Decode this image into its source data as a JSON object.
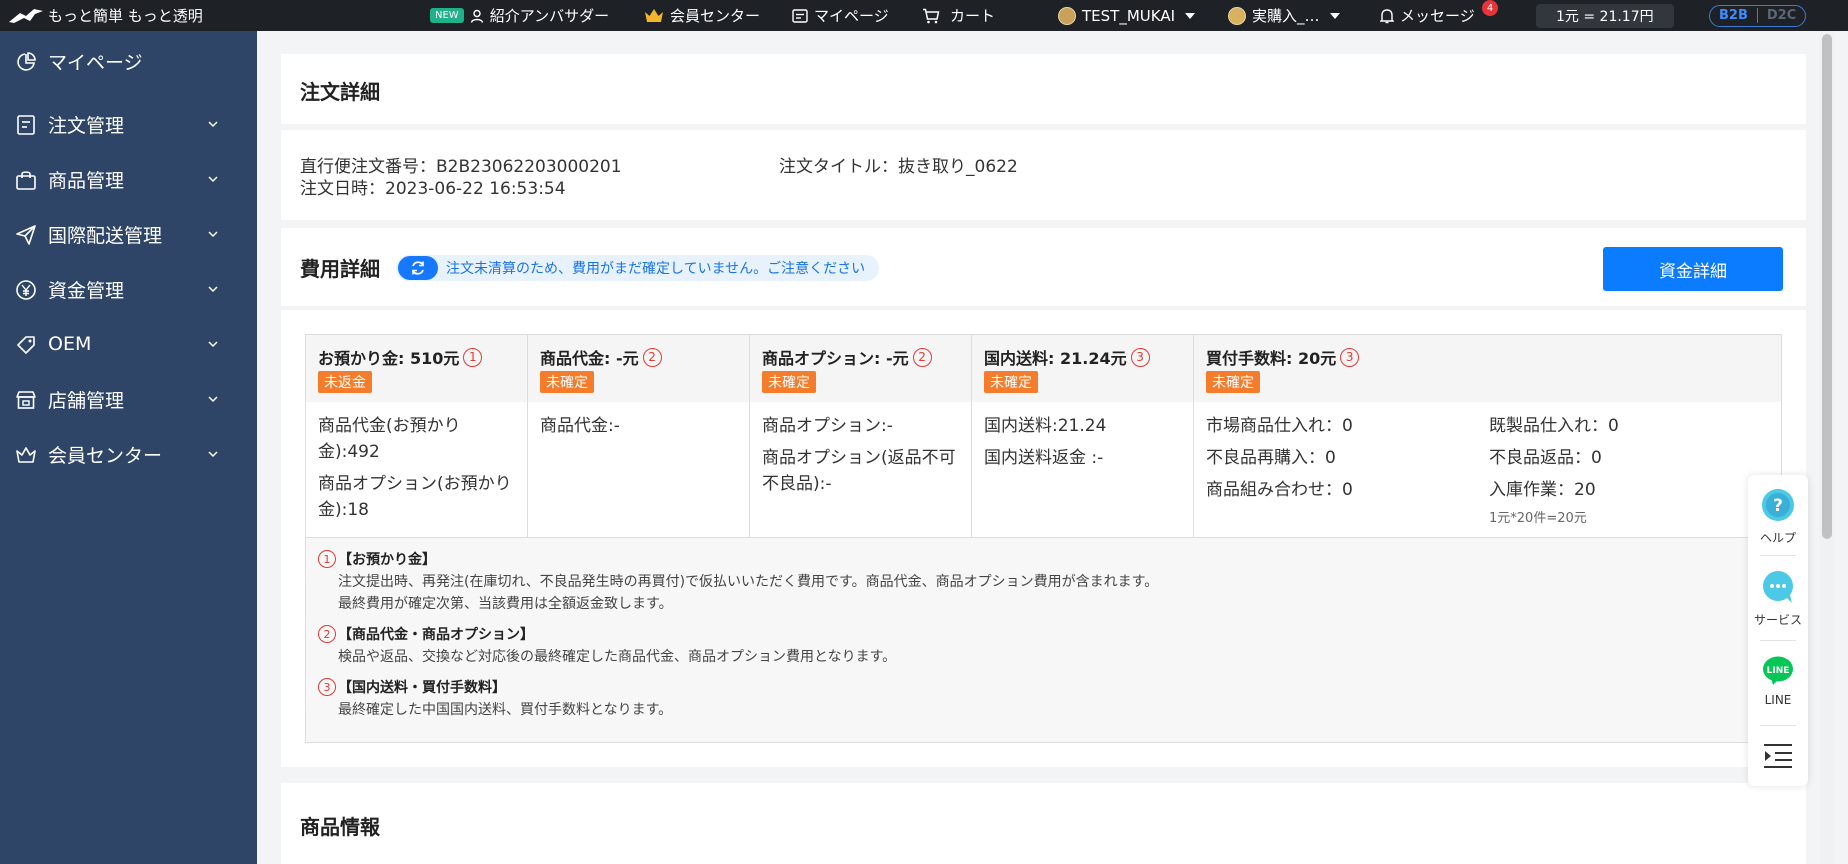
{
  "topbar": {
    "brand": "もっと簡単 もっと透明",
    "new_badge": "NEW",
    "ambassador": "紹介アンバサダー",
    "member_center": "会員センター",
    "mypage": "マイページ",
    "cart": "カート",
    "user": "TEST_MUKAI",
    "store": "実購入_…",
    "messages": "メッセージ",
    "message_count": "4",
    "exchange_rate": "1元 = 21.17円",
    "mode_b2b": "B2B",
    "mode_d2c": "D2C"
  },
  "sidebar": {
    "items": [
      {
        "label": "マイページ",
        "icon": "pie-chart-icon"
      },
      {
        "label": "注文管理",
        "icon": "order-list-icon"
      },
      {
        "label": "商品管理",
        "icon": "shopping-bag-icon"
      },
      {
        "label": "国際配送管理",
        "icon": "paper-plane-icon"
      },
      {
        "label": "資金管理",
        "icon": "yen-coin-icon"
      },
      {
        "label": "OEM",
        "icon": "tag-icon"
      },
      {
        "label": "店舗管理",
        "icon": "store-icon"
      },
      {
        "label": "会員センター",
        "icon": "crown-icon"
      }
    ]
  },
  "order_detail": {
    "title": "注文詳細",
    "order_number": "直行便注文番号：B2B23062203000201",
    "order_date": "注文日時：2023-06-22 16:53:54",
    "order_title": "注文タイトル：抜き取り_0622"
  },
  "fee_detail": {
    "title": "費用詳細",
    "notice": "注文未清算のため、費用がまだ確定していません。ご注意ください",
    "fund_button": "資金詳細",
    "columns": [
      {
        "title": "お預かり金: 510元",
        "num": "1",
        "status": "未返金",
        "lines": [
          "商品代金(お預かり",
          "金):492",
          "商品オプション(お預かり",
          "金):18"
        ]
      },
      {
        "title": "商品代金: -元",
        "num": "2",
        "status": "未確定",
        "lines": [
          "商品代金:-"
        ]
      },
      {
        "title": "商品オプション: -元",
        "num": "2",
        "status": "未確定",
        "lines": [
          "商品オプション:-",
          "商品オプション(返品不可",
          "不良品):-"
        ]
      },
      {
        "title": "国内送料: 21.24元",
        "num": "3",
        "status": "未確定",
        "lines": [
          "国内送料:21.24",
          "国内送料返金 :-"
        ]
      },
      {
        "title": "買付手数料: 20元",
        "num": "3",
        "status": "未確定",
        "lines": [
          "市場商品仕入れ：0",
          "不良品再購入：0",
          "商品組み合わせ：0",
          "既製品仕入れ：0",
          "不良品返品：0",
          "入庫作業：20"
        ],
        "sub": "1元*20件=20元"
      }
    ],
    "notes": [
      {
        "num": "1",
        "title": "【お預かり金】",
        "lines": [
          "注文提出時、再発注(在庫切れ、不良品発生時の再買付)で仮払いいただく費用です。商品代金、商品オプション費用が含まれます。",
          "最終費用が確定次第、当該費用は全額返金致します。"
        ]
      },
      {
        "num": "2",
        "title": "【商品代金・商品オプション】",
        "lines": [
          "検品や返品、交換など対応後の最終確定した商品代金、商品オプション費用となります。"
        ]
      },
      {
        "num": "3",
        "title": "【国内送料・買付手数料】",
        "lines": [
          "最終確定した中国国内送料、買付手数料となります。"
        ]
      }
    ]
  },
  "product_info": {
    "title": "商品情報"
  },
  "float_panel": {
    "help": "ヘルプ",
    "service": "サービス",
    "line": "LINE",
    "line_logo": "LINE"
  },
  "colors": {
    "sidebar_bg": "#2e4567",
    "primary": "#0b7bff",
    "tag_orange": "#f47c2a",
    "circle_red": "#e53935"
  }
}
